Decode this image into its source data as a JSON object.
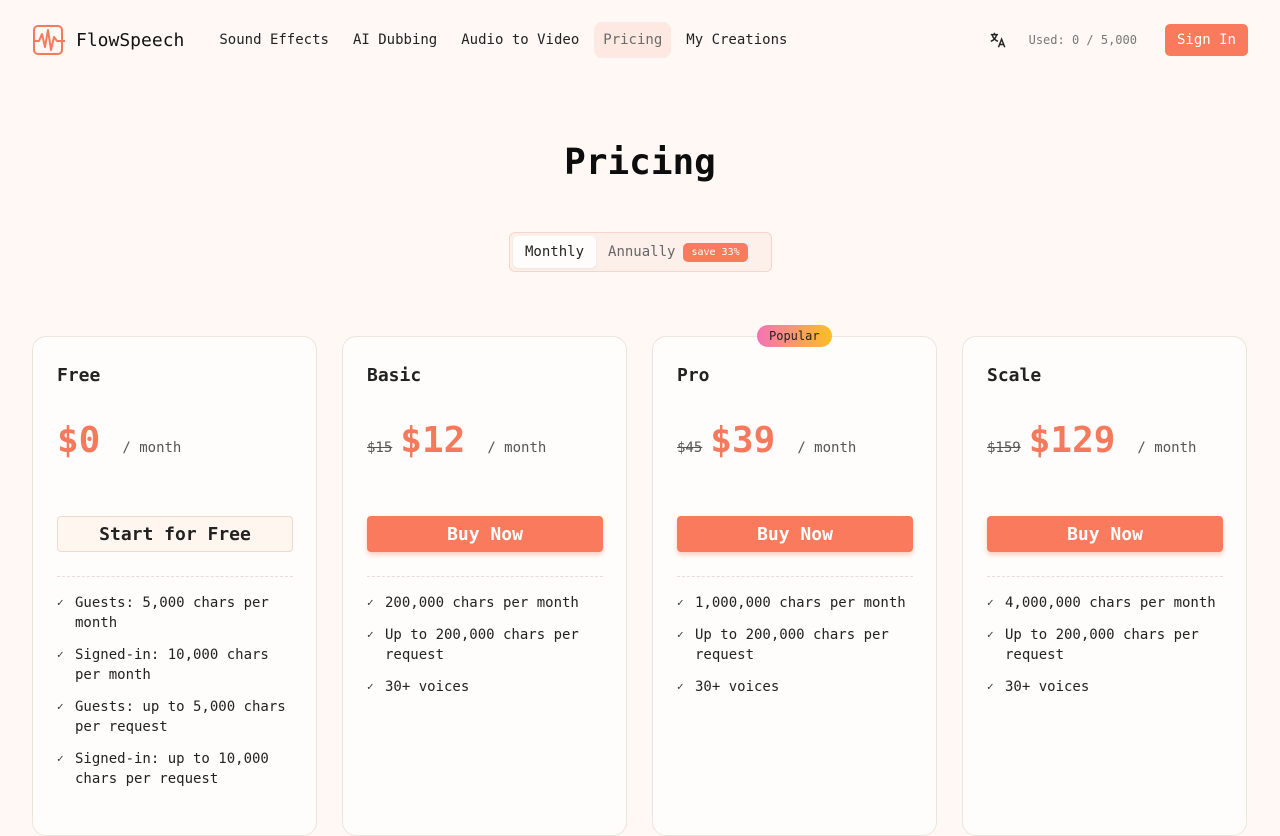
{
  "brand": {
    "name": "FlowSpeech",
    "accent": "#f97a5c"
  },
  "nav": {
    "items": [
      {
        "label": "Sound Effects",
        "active": false
      },
      {
        "label": "AI Dubbing",
        "active": false
      },
      {
        "label": "Audio to Video",
        "active": false
      },
      {
        "label": "Pricing",
        "active": true
      },
      {
        "label": "My Creations",
        "active": false
      }
    ]
  },
  "header": {
    "usage": "Used: 0 / 5,000",
    "signin_label": "Sign In",
    "translate_icon": "translate-icon"
  },
  "page": {
    "title": "Pricing"
  },
  "billing_toggle": {
    "monthly": "Monthly",
    "annually": "Annually",
    "save_badge": "save 33%",
    "selected": "Monthly"
  },
  "plans": [
    {
      "name": "Free",
      "old_price": "",
      "price": "$0",
      "per": "/ month",
      "cta": "Start for Free",
      "popular": "",
      "features": [
        "Guests: 5,000 chars per month",
        "Signed-in: 10,000 chars per month",
        "Guests: up to 5,000 chars per request",
        "Signed-in: up to 10,000 chars per request"
      ]
    },
    {
      "name": "Basic",
      "old_price": "$15",
      "price": "$12",
      "per": "/ month",
      "cta": "Buy Now",
      "popular": "",
      "features": [
        "200,000 chars per month",
        "Up to 200,000 chars per request",
        "30+ voices"
      ]
    },
    {
      "name": "Pro",
      "old_price": "$45",
      "price": "$39",
      "per": "/ month",
      "cta": "Buy Now",
      "popular": "Popular",
      "features": [
        "1,000,000 chars per month",
        "Up to 200,000 chars per request",
        "30+ voices"
      ]
    },
    {
      "name": "Scale",
      "old_price": "$159",
      "price": "$129",
      "per": "/ month",
      "cta": "Buy Now",
      "popular": "",
      "features": [
        "4,000,000 chars per month",
        "Up to 200,000 chars per request",
        "30+ voices"
      ]
    }
  ]
}
